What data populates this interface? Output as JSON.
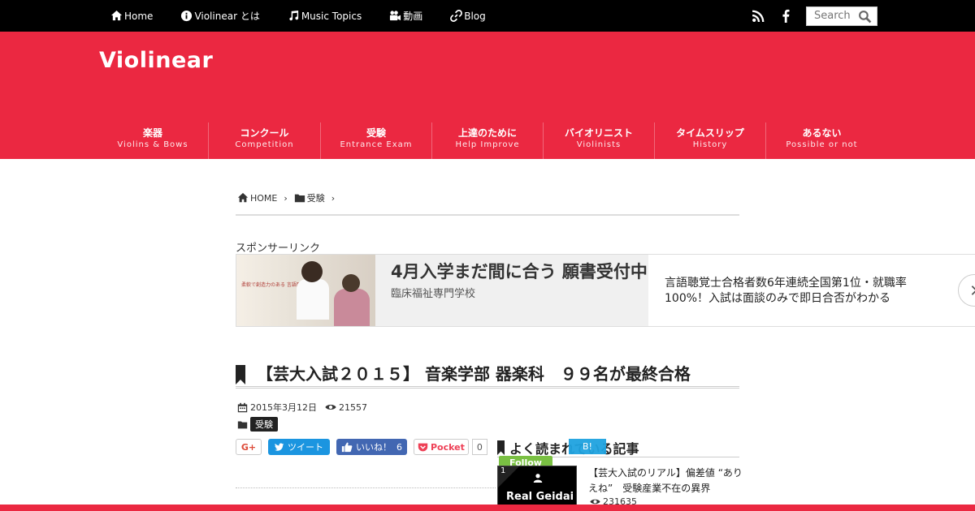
{
  "topnav": {
    "items": [
      {
        "label": "Home",
        "icon": "home-icon"
      },
      {
        "label": "Violinear とは",
        "icon": "info-icon"
      },
      {
        "label": "Music Topics",
        "icon": "music-note-icon"
      },
      {
        "label": "動画",
        "icon": "video-camera-icon"
      },
      {
        "label": "Blog",
        "icon": "link-icon"
      }
    ],
    "search_placeholder": "Search"
  },
  "header": {
    "logo": "Violinear",
    "bg_color": "#eb2841",
    "nav": [
      {
        "ja": "楽器",
        "en": "Violins & Bows"
      },
      {
        "ja": "コンクール",
        "en": "Competition"
      },
      {
        "ja": "受験",
        "en": "Entrance Exam"
      },
      {
        "ja": "上達のために",
        "en": "Help Improve"
      },
      {
        "ja": "バイオリニスト",
        "en": "Violinists"
      },
      {
        "ja": "タイムスリップ",
        "en": "History"
      },
      {
        "ja": "あるない",
        "en": "Possible or not"
      }
    ]
  },
  "breadcrumb": {
    "home": "HOME",
    "category": "受験"
  },
  "sponsor": {
    "label": "スポンサーリンク",
    "image_text": "柔軟で創造力のある 言語聴覚士になる",
    "headline": "4月入学まだ間に合う 願書受付中",
    "advertiser": "臨床福祉専門学校",
    "description": "言語聴覚士合格者数6年連続全国第1位・就職率100%！入試は面談のみで即日合否がわかる"
  },
  "article": {
    "title": "【芸大入試２０１５】 音楽学部 器楽科　９９名が最終合格",
    "date": "2015年3月12日",
    "views": "21557",
    "category": "受験"
  },
  "share": {
    "gplus": "G+",
    "tweet": "ツイート",
    "like": "いいね！",
    "like_count": "6",
    "pocket": "Pocket",
    "pocket_count": "0"
  },
  "popular": {
    "heading": "よく読まれている記事",
    "overlay_label": "B!",
    "follow_label": "Follow",
    "items": [
      {
        "rank": "1",
        "thumb_text": "Real Geidai",
        "title": "【芸大入試のリアル】偏差値 “ありえね”　受験産業不在の異界",
        "views": "231635"
      }
    ]
  }
}
